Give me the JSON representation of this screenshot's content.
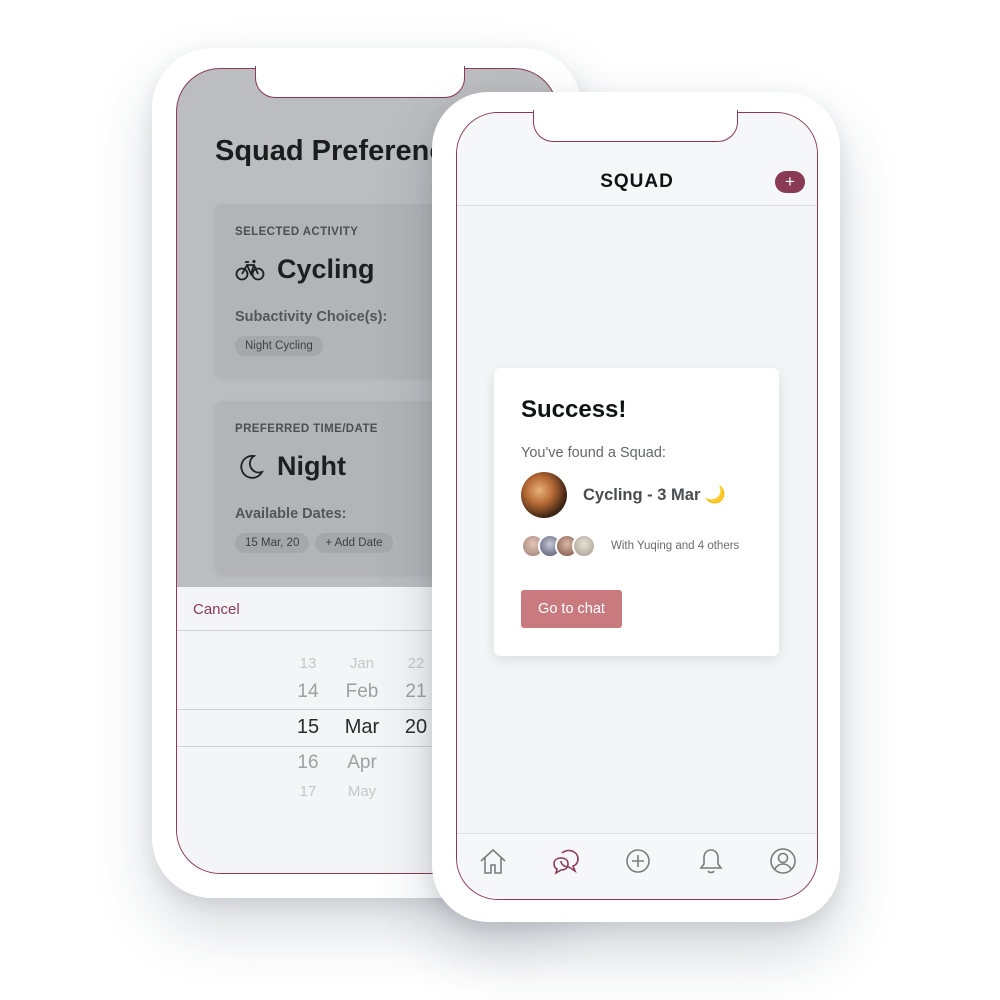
{
  "back_screen": {
    "title": "Squad Preferenc",
    "activity_card": {
      "label": "SELECTED ACTIVITY",
      "value": "Cycling",
      "icon": "bicycle-icon",
      "sub_label": "Subactivity Choice(s):",
      "chips": [
        "Night Cycling"
      ]
    },
    "time_card": {
      "label": "PREFERRED TIME/DATE",
      "value": "Night",
      "icon": "moon-icon",
      "sub_label": "Available Dates:",
      "chips": [
        "15 Mar, 20",
        "+ Add Date"
      ]
    },
    "picker": {
      "cancel_label": "Cancel",
      "rows": [
        {
          "day": "13",
          "month": "Jan",
          "year": "22"
        },
        {
          "day": "14",
          "month": "Feb",
          "year": "21"
        },
        {
          "day": "15",
          "month": "Mar",
          "year": "20"
        },
        {
          "day": "16",
          "month": "Apr",
          "year": ""
        },
        {
          "day": "17",
          "month": "May",
          "year": ""
        }
      ]
    }
  },
  "front_screen": {
    "app_title": "SQUAD",
    "add_button_label": "+",
    "modal": {
      "title": "Success!",
      "message": "You've found a Squad:",
      "event": "Cycling - 3 Mar",
      "event_emoji": "🌙",
      "participants_text": "With Yuqing and 4 others",
      "button_label": "Go to chat"
    },
    "tabbar": [
      "home-icon",
      "chat-icon",
      "plus-circle-icon",
      "bell-icon",
      "profile-icon"
    ]
  },
  "colors": {
    "accent": "#8a3a55",
    "button": "#c87a7f",
    "overlay": "#bcbdc0"
  }
}
